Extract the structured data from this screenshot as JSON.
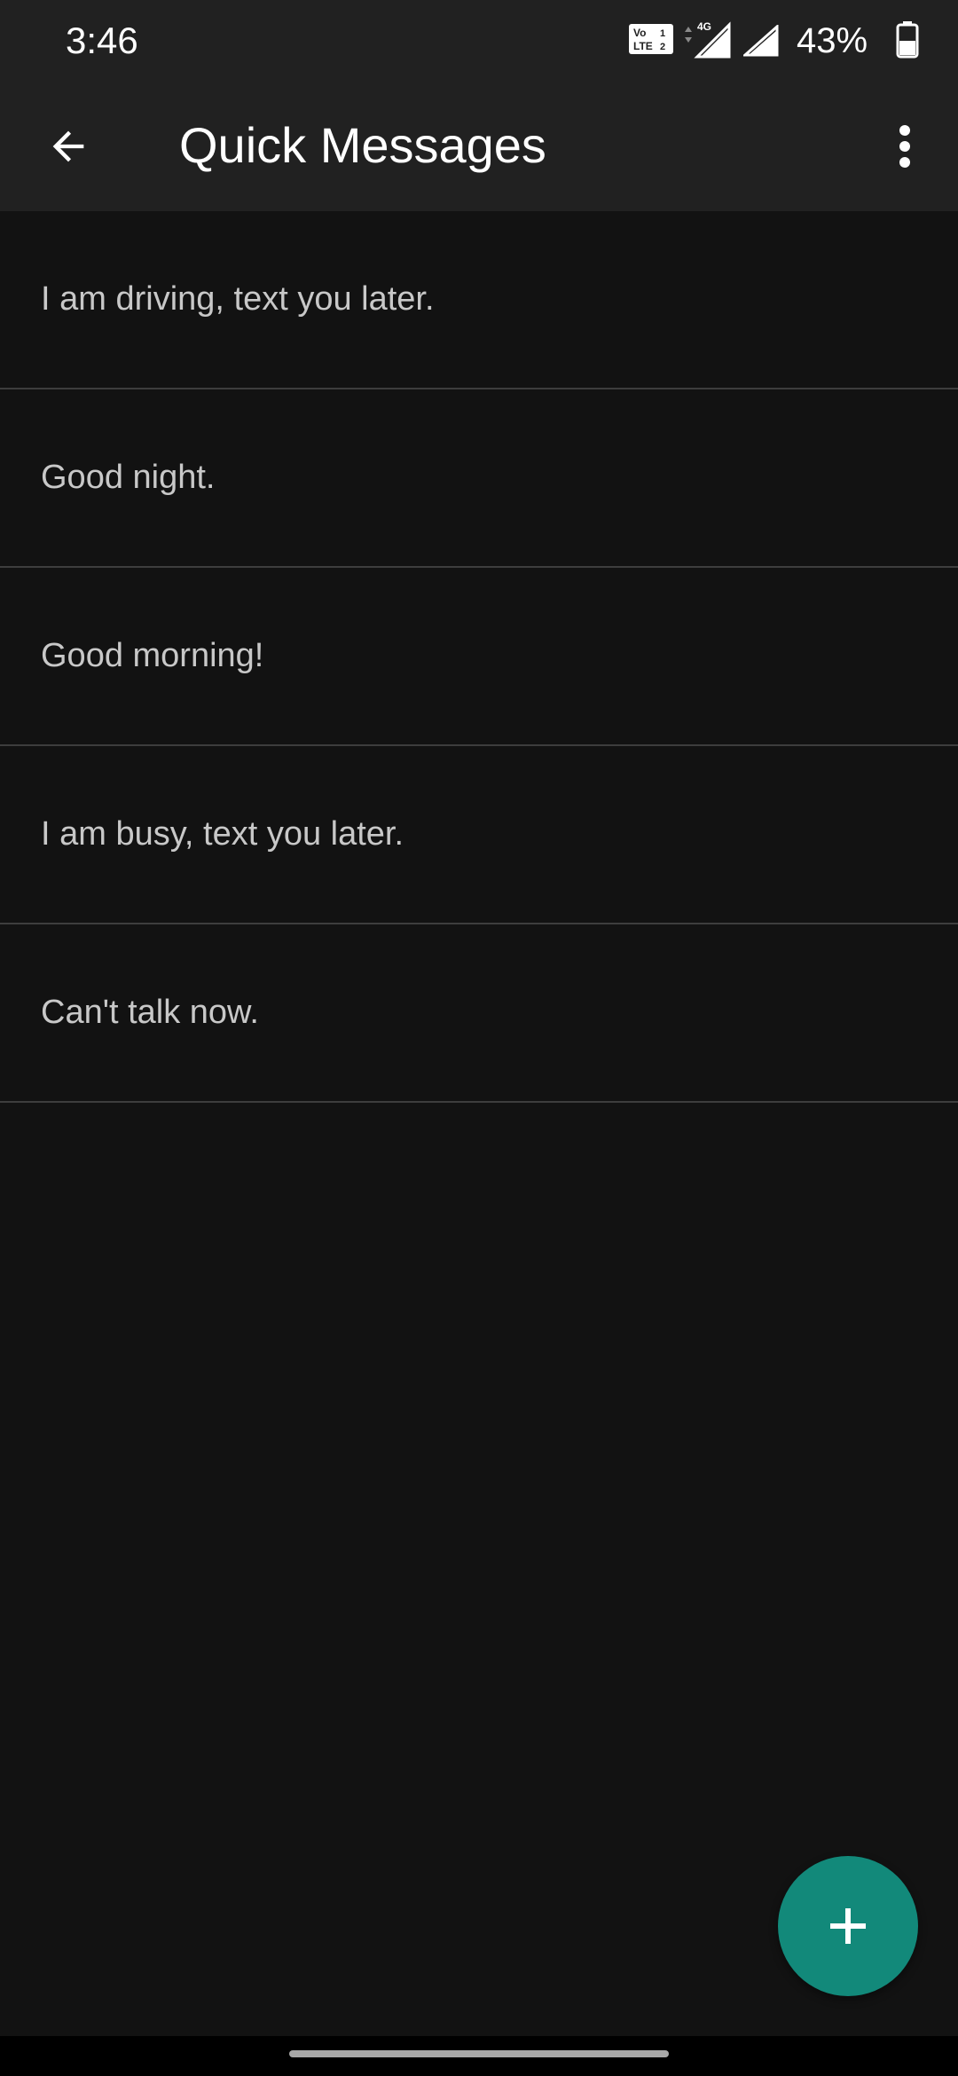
{
  "status_bar": {
    "time": "3:46",
    "battery": "43%",
    "icons": [
      "volte-icon",
      "4g-signal-icon",
      "signal-icon",
      "battery-icon"
    ]
  },
  "app_bar": {
    "title": "Quick Messages",
    "back_icon": "arrow-left-icon",
    "menu_icon": "more-vert-icon"
  },
  "messages": [
    "I am driving, text you later.",
    "Good night.",
    "Good morning!",
    "I am busy, text you later.",
    "Can't talk now."
  ],
  "fab": {
    "icon": "plus-icon",
    "color": "#12897a"
  },
  "colors": {
    "background": "#121212",
    "app_bar": "#212121",
    "accent": "#12897a"
  }
}
